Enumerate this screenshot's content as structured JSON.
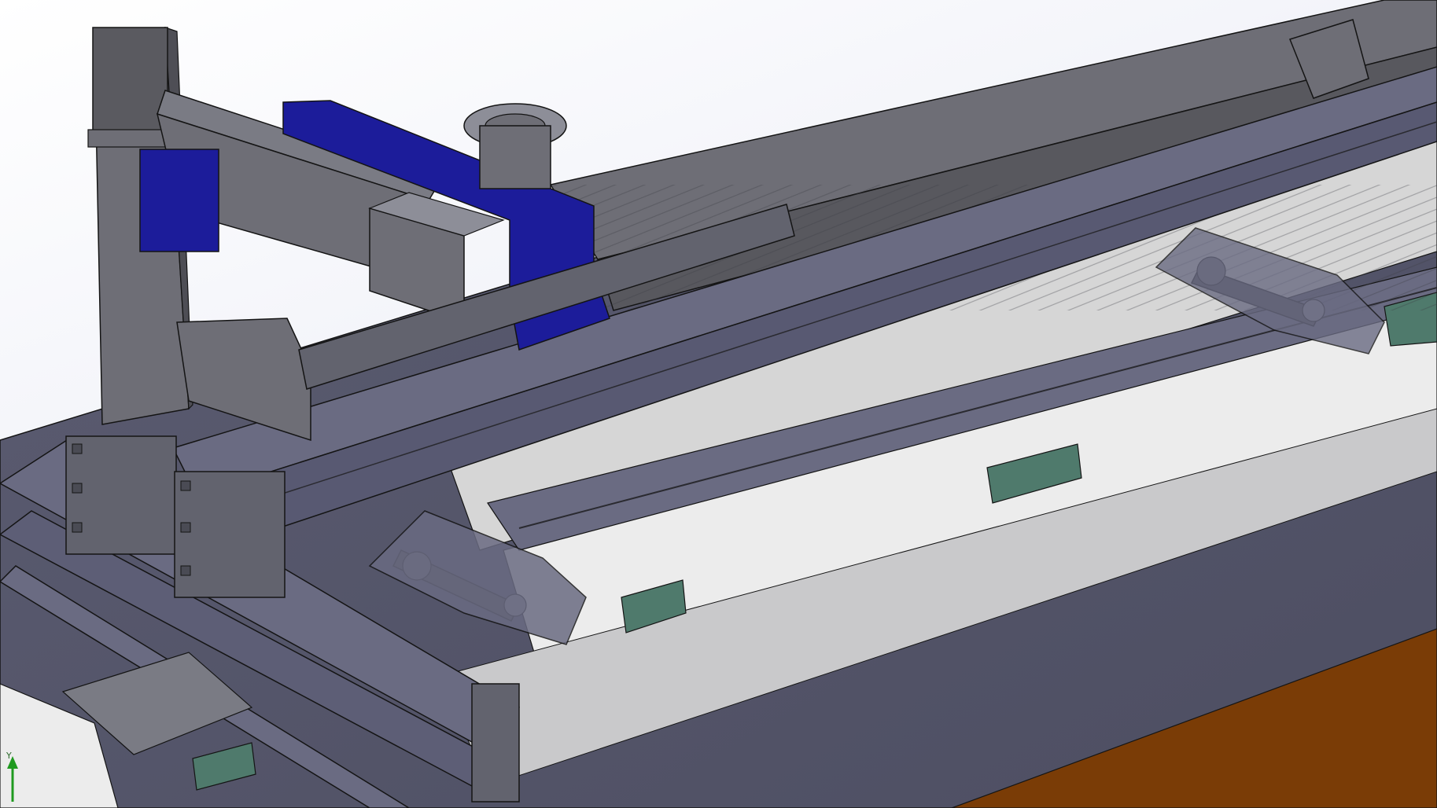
{
  "viewport": {
    "background_top": "#ffffff",
    "background_bottom": "#d9dbe8"
  },
  "colors": {
    "aluminum_dark": "#58585e",
    "aluminum_mid": "#6e6e76",
    "aluminum_light": "#8d8e98",
    "frame_blue_grey": "#6a6b82",
    "plate_light": "#d6d6d6",
    "plate_white": "#ececec",
    "carriage_blue": "#1c1c9a",
    "bearing_green": "#4f7a6c",
    "base_orange": "#7a3c06",
    "edge": "#141414",
    "triad_green": "#1f9a1f"
  },
  "icons": {
    "triad": "coordinate-triad-icon"
  },
  "triad": {
    "axis_label": "Y"
  }
}
